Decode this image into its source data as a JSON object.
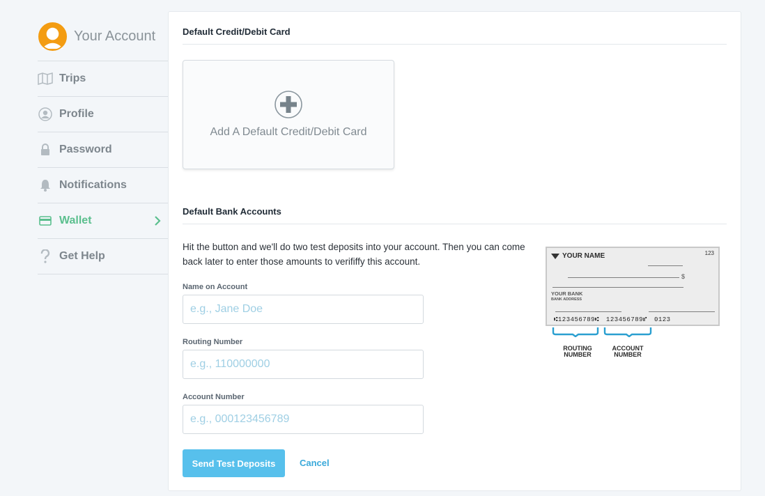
{
  "sidebar": {
    "title": "Your Account",
    "items": [
      {
        "label": "Trips",
        "icon": "map-icon"
      },
      {
        "label": "Profile",
        "icon": "user-icon"
      },
      {
        "label": "Password",
        "icon": "lock-icon"
      },
      {
        "label": "Notifications",
        "icon": "bell-icon"
      },
      {
        "label": "Wallet",
        "icon": "card-icon",
        "active": true
      },
      {
        "label": "Get Help",
        "icon": "question-icon"
      }
    ]
  },
  "card_section": {
    "title": "Default Credit/Debit Card",
    "add_label": "Add A Default Credit/Debit Card"
  },
  "bank_section": {
    "title": "Default Bank Accounts",
    "intro": "Hit the button and we'll do two test deposits into your account. Then you can come back later to enter those amounts to verififfy this account.",
    "fields": {
      "name": {
        "label": "Name on Account",
        "placeholder": "e.g., Jane Doe"
      },
      "routing": {
        "label": "Routing Number",
        "placeholder": "e.g., 110000000"
      },
      "account": {
        "label": "Account Number",
        "placeholder": "e.g., 000123456789"
      }
    },
    "send_label": "Send Test Deposits",
    "cancel_label": "Cancel"
  },
  "check": {
    "name": "YOUR NAME",
    "number": "123",
    "bank_name": "YOUR BANK",
    "bank_address": "BANK ADDRESS",
    "dollar_sign": "$",
    "routing_digits": "⑆123456789⑆",
    "account_digits": "123456789⑈",
    "check_digits": "0123",
    "routing_caption_1": "ROUTING",
    "routing_caption_2": "NUMBER",
    "account_caption_1": "ACCOUNT",
    "account_caption_2": "NUMBER"
  },
  "colors": {
    "accent_green": "#5bbf8e",
    "button_blue": "#57c0ec",
    "link_blue": "#3aa9da",
    "avatar_orange": "#f39c12",
    "check_bracket": "#2a9fd0"
  }
}
